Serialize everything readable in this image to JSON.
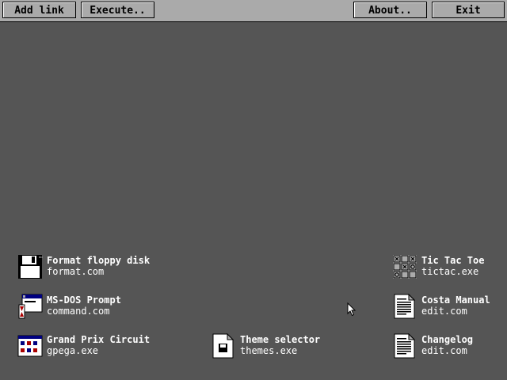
{
  "toolbar": {
    "add_link": "Add link",
    "execute": "Execute..",
    "about": "About..",
    "exit": "Exit"
  },
  "desktop": {
    "items": [
      {
        "title": "Format floppy disk",
        "file": "format.com",
        "icon": "floppy-disk-icon"
      },
      {
        "title": "MS-DOS Prompt",
        "file": "command.com",
        "icon": "dos-prompt-icon"
      },
      {
        "title": "Grand Prix Circuit",
        "file": "gpega.exe",
        "icon": "game-icon"
      },
      {
        "title": "Theme selector",
        "file": "themes.exe",
        "icon": "theme-document-icon"
      },
      {
        "title": "Tic Tac Toe",
        "file": "tictac.exe",
        "icon": "tic-tac-toe-icon"
      },
      {
        "title": "Costa Manual",
        "file": "edit.com",
        "icon": "text-document-icon"
      },
      {
        "title": "Changelog",
        "file": "edit.com",
        "icon": "text-document-icon"
      }
    ]
  },
  "colors": {
    "desktop_bg": "#555555",
    "toolbar_bg": "#aaaaaa",
    "text": "#ffffff"
  }
}
